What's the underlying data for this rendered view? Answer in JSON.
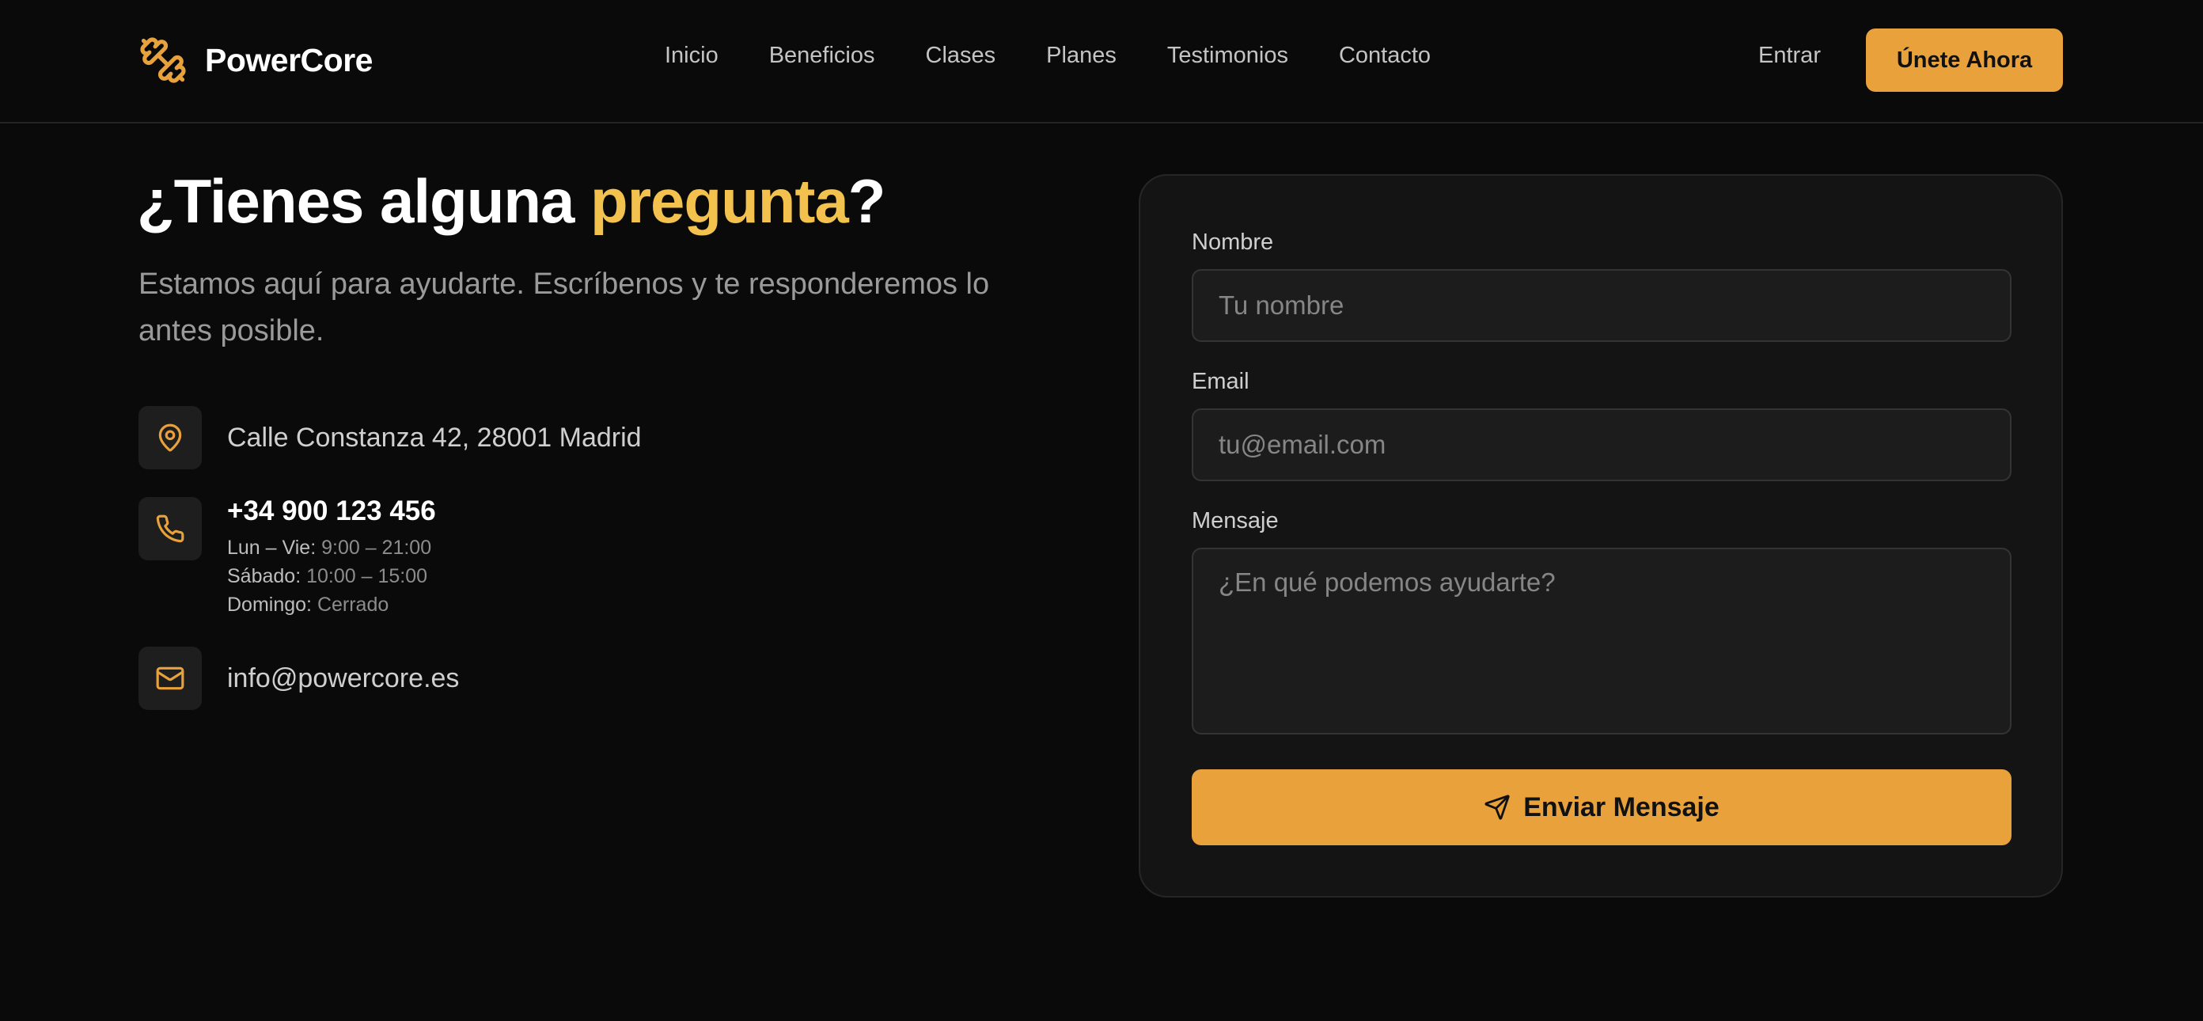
{
  "colors": {
    "background": "#0a0a0a",
    "accent": "#e9a23b",
    "accent_text": "#f2c14e",
    "card": "#141414"
  },
  "header": {
    "brand": "PowerCore",
    "logo_icon": "dumbbell-icon",
    "nav": [
      "Inicio",
      "Beneficios",
      "Clases",
      "Planes",
      "Testimonios",
      "Contacto"
    ],
    "login_label": "Entrar",
    "cta_label": "Únete Ahora"
  },
  "contact": {
    "heading_start": "¿Tienes alguna ",
    "heading_accent": "pregunta",
    "heading_end": "?",
    "subtitle": "Estamos aquí para ayudarte. Escríbenos y te responderemos lo antes posible.",
    "address": {
      "icon": "map-pin-icon",
      "text": "Calle Constanza 42, 28001 Madrid"
    },
    "phone": {
      "icon": "phone-icon",
      "number": "+34 900 123 456",
      "hours": [
        {
          "day": "Lun – Vie:",
          "time": "9:00 – 21:00"
        },
        {
          "day": "Sábado:",
          "time": "10:00 – 15:00"
        },
        {
          "day": "Domingo:",
          "time": "Cerrado"
        }
      ]
    },
    "email": {
      "icon": "mail-icon",
      "text": "info@powercore.es"
    }
  },
  "form": {
    "name_label": "Nombre",
    "name_placeholder": "Tu nombre",
    "email_label": "Email",
    "email_placeholder": "tu@email.com",
    "message_label": "Mensaje",
    "message_placeholder": "¿En qué podemos ayudarte?",
    "submit_label": "Enviar Mensaje",
    "submit_icon": "send-icon"
  }
}
